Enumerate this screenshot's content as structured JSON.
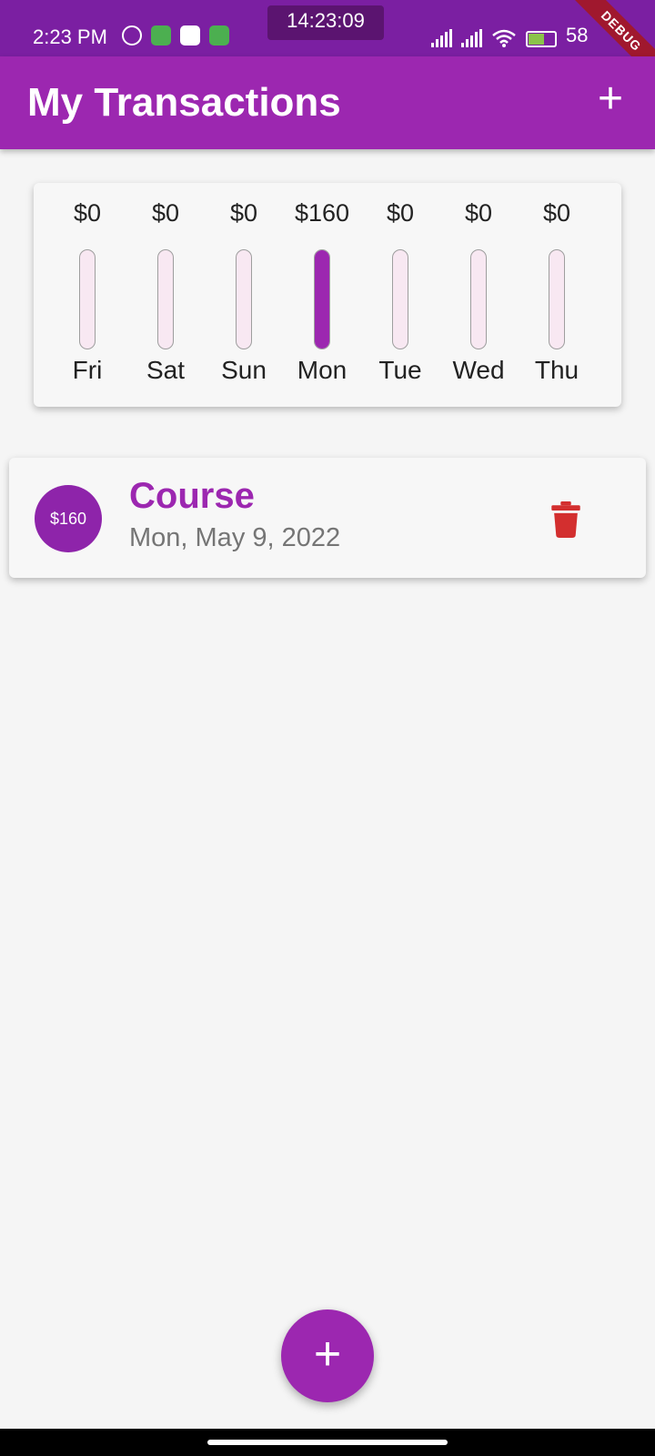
{
  "status_bar": {
    "time": "2:23 PM",
    "center_clock": "14:23:09",
    "battery_text": "58",
    "debug_banner": "DEBUG"
  },
  "app_bar": {
    "title": "My Transactions",
    "add_icon": "plus-icon",
    "add_glyph": "+"
  },
  "chart_data": {
    "type": "bar",
    "categories": [
      "Fri",
      "Sat",
      "Sun",
      "Mon",
      "Tue",
      "Wed",
      "Thu"
    ],
    "values": [
      0,
      0,
      0,
      160,
      0,
      0,
      0
    ],
    "labels": [
      "$0",
      "$0",
      "$0",
      "$160",
      "$0",
      "$0",
      "$0"
    ],
    "fill_fraction": [
      0,
      0,
      0,
      1,
      0,
      0,
      0
    ]
  },
  "transactions": [
    {
      "amount": "$160",
      "title": "Course",
      "date": "Mon, May 9, 2022",
      "delete_icon": "trash-icon"
    }
  ],
  "fab": {
    "icon": "plus-icon",
    "glyph": "+"
  },
  "colors": {
    "primary": "#9c27b0",
    "status_bar": "#7b1fa2",
    "delete": "#d32f2f",
    "bar_empty": "#f8e8f2"
  }
}
